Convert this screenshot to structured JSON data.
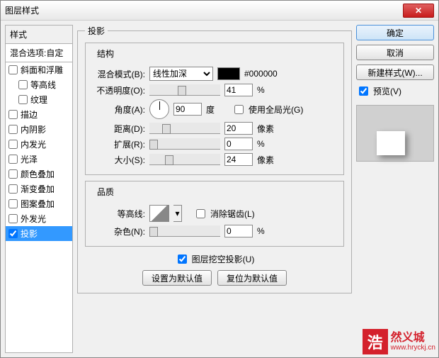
{
  "window": {
    "title": "图层样式"
  },
  "left": {
    "header": "样式",
    "sub": "混合选项:自定",
    "items": [
      {
        "label": "斜面和浮雕",
        "checked": false,
        "indent": false
      },
      {
        "label": "等高线",
        "checked": false,
        "indent": true
      },
      {
        "label": "纹理",
        "checked": false,
        "indent": true
      },
      {
        "label": "描边",
        "checked": false,
        "indent": false
      },
      {
        "label": "内阴影",
        "checked": false,
        "indent": false
      },
      {
        "label": "内发光",
        "checked": false,
        "indent": false
      },
      {
        "label": "光泽",
        "checked": false,
        "indent": false
      },
      {
        "label": "颜色叠加",
        "checked": false,
        "indent": false
      },
      {
        "label": "渐变叠加",
        "checked": false,
        "indent": false
      },
      {
        "label": "图案叠加",
        "checked": false,
        "indent": false
      },
      {
        "label": "外发光",
        "checked": false,
        "indent": false
      },
      {
        "label": "投影",
        "checked": true,
        "indent": false,
        "selected": true
      }
    ]
  },
  "mid": {
    "section_title": "投影",
    "structure_title": "结构",
    "blend_mode_label": "混合模式(B):",
    "blend_mode_value": "线性加深",
    "color_hex": "#000000",
    "opacity_label": "不透明度(O):",
    "opacity_value": "41",
    "opacity_unit": "%",
    "angle_label": "角度(A):",
    "angle_value": "90",
    "angle_unit": "度",
    "use_global_label": "使用全局光(G)",
    "use_global_checked": false,
    "distance_label": "距离(D):",
    "distance_value": "20",
    "distance_unit": "像素",
    "spread_label": "扩展(R):",
    "spread_value": "0",
    "spread_unit": "%",
    "size_label": "大小(S):",
    "size_value": "24",
    "size_unit": "像素",
    "quality_title": "品质",
    "contour_label": "等高线:",
    "antialias_label": "消除锯齿(L)",
    "antialias_checked": false,
    "noise_label": "杂色(N):",
    "noise_value": "0",
    "noise_unit": "%",
    "knockout_label": "图层挖空投影(U)",
    "knockout_checked": true,
    "make_default": "设置为默认值",
    "reset_default": "复位为默认值"
  },
  "right": {
    "ok": "确定",
    "cancel": "取消",
    "new_style": "新建样式(W)...",
    "preview_label": "预览(V)",
    "preview_checked": true
  },
  "brand": {
    "char": "浩",
    "text": "然义城",
    "url": "www.hryckj.cn"
  }
}
